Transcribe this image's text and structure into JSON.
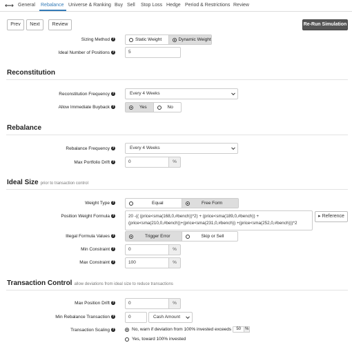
{
  "nav": {
    "arrows": "⟷",
    "tabs": [
      "General",
      "Rebalance",
      "Universe & Ranking",
      "Buy",
      "Sell",
      "Stop Loss",
      "Hedge",
      "Period & Restrictions",
      "Review"
    ],
    "active_tab": "Rebalance"
  },
  "toolbar": {
    "prev": "Prev",
    "next": "Next",
    "review": "Review",
    "rerun": "Re-Run Simulation"
  },
  "sizing": {
    "method_label": "Sizing Method",
    "method_options": [
      "Static Weight",
      "Dynamic Weight"
    ],
    "method_selected": "Dynamic Weight",
    "positions_label": "Ideal Number of Positions",
    "positions_value": "5"
  },
  "reconstitution": {
    "title": "Reconstitution",
    "frequency_label": "Reconstitution Frequency",
    "frequency_value": "Every 4 Weeks",
    "buyback_label": "Allow Immediate Buyback",
    "buyback_options": [
      "Yes",
      "No"
    ],
    "buyback_selected": "Yes"
  },
  "rebalance": {
    "title": "Rebalance",
    "frequency_label": "Rebalance Frequency",
    "frequency_value": "Every 4 Weeks",
    "drift_label": "Max Portfolio Drift",
    "drift_value": "0",
    "drift_unit": "%"
  },
  "ideal_size": {
    "title": "Ideal Size",
    "subtitle": "prior to transaction control",
    "weight_type_label": "Weight Type",
    "weight_type_options": [
      "Equal",
      "Free Form"
    ],
    "weight_type_selected": "Free Form",
    "formula_label": "Position Weight Formula",
    "formula_value": "20 -(( (price<sma(168,0,#bench))*2) + (price<sma(189,0,#bench)) + (price<sma(210,0,#bench))+(price<sma(231,0,#bench)) +(price<sma(252,0,#bench)))*2",
    "reference_label": "Reference",
    "illegal_label": "Illegal Formula Values",
    "illegal_options": [
      "Trigger Error",
      "Skip or Sell"
    ],
    "illegal_selected": "Trigger Error",
    "min_label": "Min Constraint",
    "min_value": "0",
    "max_label": "Max Constraint",
    "max_value": "100",
    "unit": "%"
  },
  "transaction": {
    "title": "Transaction Control",
    "subtitle": "allow deviations from ideal size to reduce transactions",
    "max_drift_label": "Max Position Drift",
    "max_drift_value": "0",
    "min_rebalance_label": "Min Rebalance Transaction",
    "min_rebalance_value": "0",
    "min_rebalance_type": "Cash Amount",
    "scaling_label": "Transaction Scaling",
    "scaling_option1": "No, warn if deviation from 100% invested exceeds",
    "scaling_option1_value": "50",
    "scaling_option2": "Yes, toward 100% invested",
    "unit": "%"
  },
  "help_icon_glyph": "?"
}
